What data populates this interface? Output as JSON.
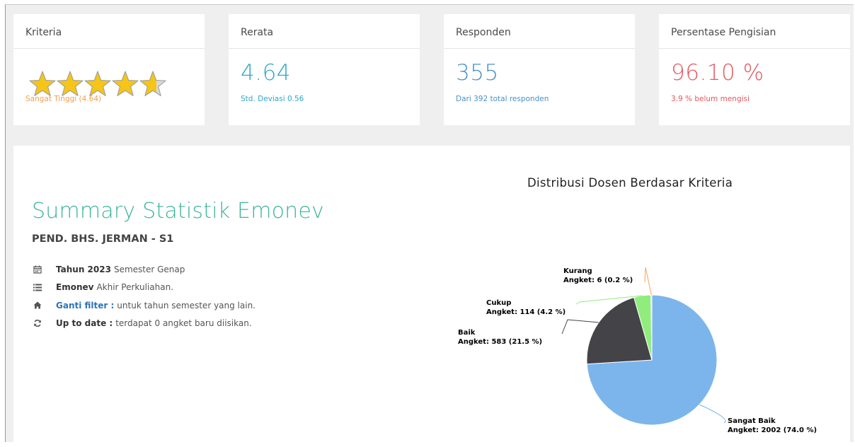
{
  "cards": {
    "kriteria": {
      "title": "Kriteria",
      "rating": 4.64,
      "max": 5,
      "caption": "Sangat Tinggi (4.64)"
    },
    "rerata": {
      "title": "Rerata",
      "value": "4.64",
      "caption": "Std. Deviasi 0.56"
    },
    "responden": {
      "title": "Responden",
      "value": "355",
      "caption": "Dari 392 total responden"
    },
    "persentase": {
      "title": "Persentase Pengisian",
      "value": "96.10 %",
      "caption": "3.9 % belum mengisi"
    }
  },
  "summary": {
    "title": "Summary Statistik Emonev",
    "prodi": "PEND. BHS. JERMAN - S1",
    "items": [
      {
        "icon": "calendar-icon",
        "bold": "Tahun 2023",
        "text": " Semester Genap"
      },
      {
        "icon": "list-icon",
        "bold": "Emonev",
        "text": " Akhir Perkuliahan."
      },
      {
        "icon": "home-icon",
        "link": "Ganti filter :",
        "text": " untuk tahun semester yang lain."
      },
      {
        "icon": "refresh-icon",
        "bold": "Up to date :",
        "text": " terdapat 0 angket baru diisikan."
      }
    ]
  },
  "colors": {
    "star": "#f5c518",
    "teal": "#3db59b"
  },
  "chart_data": {
    "type": "pie",
    "title": "Distribusi Dosen Berdasar Kriteria",
    "slices": [
      {
        "name": "Sangat Baik",
        "label": "Angket: 2002 (74.0 %)",
        "value": 2002,
        "color": "#7cb5ec"
      },
      {
        "name": "Baik",
        "label": "Angket: 583 (21.5 %)",
        "value": 583,
        "color": "#434348"
      },
      {
        "name": "Cukup",
        "label": "Angket: 114 (4.2 %)",
        "value": 114,
        "color": "#90ed7d"
      },
      {
        "name": "Kurang",
        "label": "Angket: 6 (0.2 %)",
        "value": 6,
        "color": "#f7a35c"
      }
    ]
  }
}
